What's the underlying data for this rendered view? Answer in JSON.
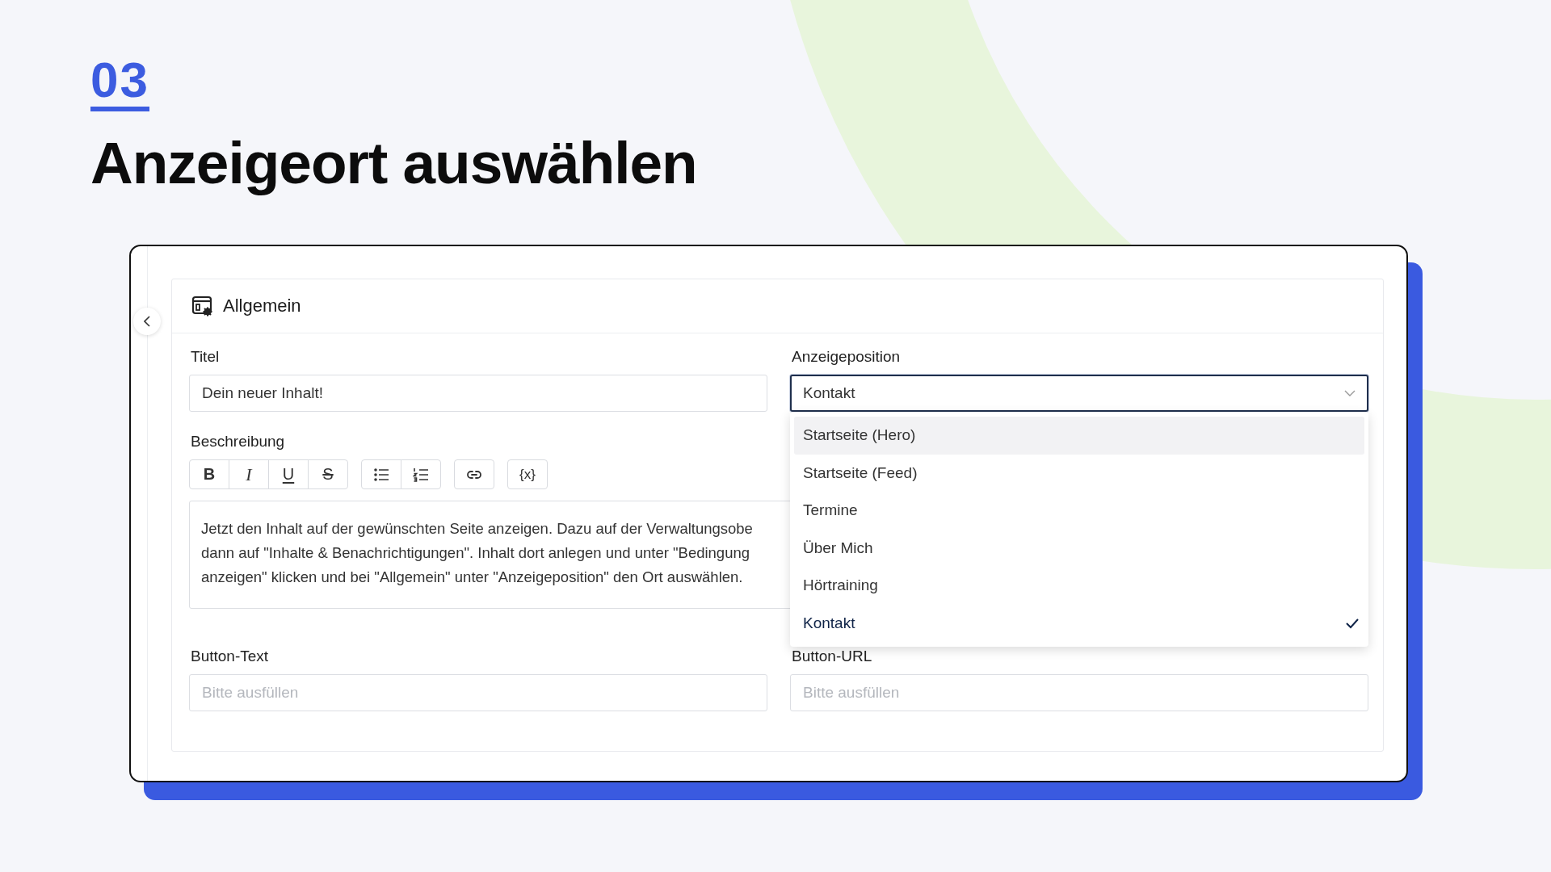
{
  "step": "03",
  "title": "Anzeigeort auswählen",
  "section": {
    "title": "Allgemein"
  },
  "fields": [
    {
      "kind": "text",
      "label": "Titel",
      "value": "Dein neuer Inhalt!"
    },
    {
      "kind": "select",
      "label": "Anzeigeposition",
      "value": "Kontakt",
      "expanded": true,
      "options": [
        {
          "label": "Startseite (Hero)",
          "highlighted": true,
          "selected": false
        },
        {
          "label": "Startseite (Feed)",
          "highlighted": false,
          "selected": false
        },
        {
          "label": "Termine",
          "highlighted": false,
          "selected": false
        },
        {
          "label": "Über Mich",
          "highlighted": false,
          "selected": false
        },
        {
          "label": "Hörtraining",
          "highlighted": false,
          "selected": false
        },
        {
          "label": "Kontakt",
          "highlighted": false,
          "selected": true
        }
      ]
    }
  ],
  "editor": {
    "label": "Beschreibung",
    "toolbar": [
      [
        {
          "kind": "bold",
          "text": "B"
        },
        {
          "kind": "italic",
          "text": "I"
        },
        {
          "kind": "underline",
          "text": "U"
        },
        {
          "kind": "strike",
          "text": "S"
        }
      ],
      [
        {
          "kind": "bullets"
        },
        {
          "kind": "numbers"
        }
      ],
      [
        {
          "kind": "link"
        }
      ],
      [
        {
          "kind": "variable",
          "text": "{x}"
        }
      ]
    ],
    "lines": [
      "Jetzt den Inhalt auf der gewünschten Seite anzeigen. Dazu auf der Verwaltungsobe",
      "dann auf \"Inhalte & Benachrichtigungen\". Inhalt dort anlegen und unter \"Bedingung",
      "anzeigen\" klicken und bei \"Allgemein\" unter \"Anzeigeposition\" den Ort auswählen."
    ]
  },
  "bottom_fields": [
    {
      "label": "Button-Text",
      "placeholder": "Bitte ausfüllen"
    },
    {
      "label": "Button-URL",
      "placeholder": "Bitte ausfüllen"
    }
  ]
}
